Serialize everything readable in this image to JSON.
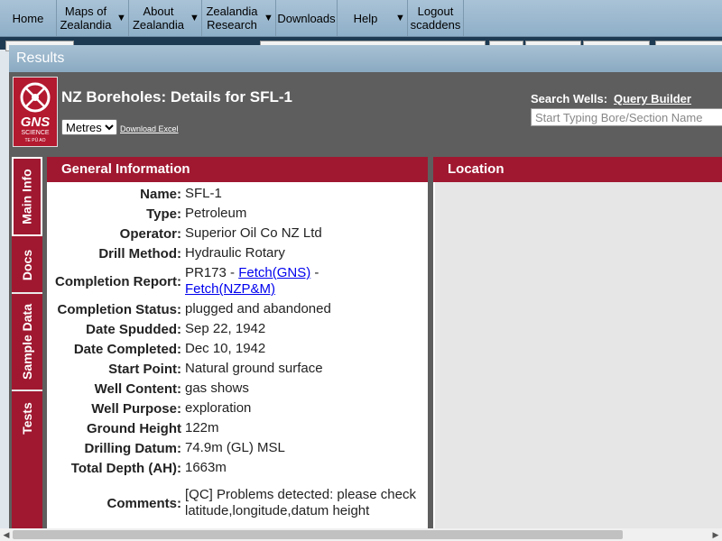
{
  "nav": {
    "items": [
      {
        "label": "Home",
        "has_arrow": false
      },
      {
        "label": "Maps of Zealandia",
        "has_arrow": true
      },
      {
        "label": "About Zealandia",
        "has_arrow": true
      },
      {
        "label": "Zealandia Research",
        "has_arrow": true
      },
      {
        "label": "Downloads",
        "has_arrow": false
      },
      {
        "label": "Help",
        "has_arrow": true
      },
      {
        "label": "Logout scaddens",
        "has_arrow": false
      }
    ],
    "arrow_glyph": "▼",
    "colors": {
      "bar": "#9bb8ce"
    }
  },
  "results": {
    "title": "Results",
    "page_title": "NZ Boreholes: Details for SFL-1",
    "units_selected": "Metres",
    "download_link": "Download Excel",
    "search_label": "Search Wells:",
    "query_builder": "Query Builder",
    "search_placeholder": "Start Typing Bore/Section Name",
    "logo": {
      "text": "GNS",
      "sub": "SCIENCE",
      "tag": "TE PŪ AO"
    }
  },
  "tabs": [
    {
      "label": "Main Info",
      "active": true
    },
    {
      "label": "Docs",
      "active": false
    },
    {
      "label": "Sample Data",
      "active": false
    },
    {
      "label": "Tests",
      "active": false
    }
  ],
  "general_info": {
    "heading": "General Information",
    "rows": [
      {
        "key": "Name:",
        "value": "SFL-1"
      },
      {
        "key": "Type:",
        "value": "Petroleum"
      },
      {
        "key": "Operator:",
        "value": "Superior Oil Co NZ Ltd"
      },
      {
        "key": "Drill Method:",
        "value": "Hydraulic Rotary"
      },
      {
        "key": "Completion Report:",
        "value": "PR173 -",
        "link1": "Fetch(GNS)",
        "sep": " -",
        "link2": "Fetch(NZP&M)"
      },
      {
        "key": "Completion Status:",
        "value": "plugged and abandoned"
      },
      {
        "key": "Date Spudded:",
        "value": "Sep 22, 1942"
      },
      {
        "key": "Date Completed:",
        "value": "Dec 10, 1942"
      },
      {
        "key": "Start Point:",
        "value": "Natural ground surface"
      },
      {
        "key": "Well Content:",
        "value": "gas shows"
      },
      {
        "key": "Well Purpose:",
        "value": "exploration"
      },
      {
        "key": "Ground Height",
        "value": "122m"
      },
      {
        "key": "Drilling Datum:",
        "value": "74.9m (GL) MSL"
      },
      {
        "key": "Total Depth (AH):",
        "value": "1663m"
      },
      {
        "key": "Comments:",
        "value": "[QC] Problems detected: please check latitude,longitude,datum height"
      }
    ]
  },
  "location": {
    "heading": "Location"
  },
  "colors": {
    "accent": "#a01830",
    "header_bg": "#5e5e5e"
  }
}
